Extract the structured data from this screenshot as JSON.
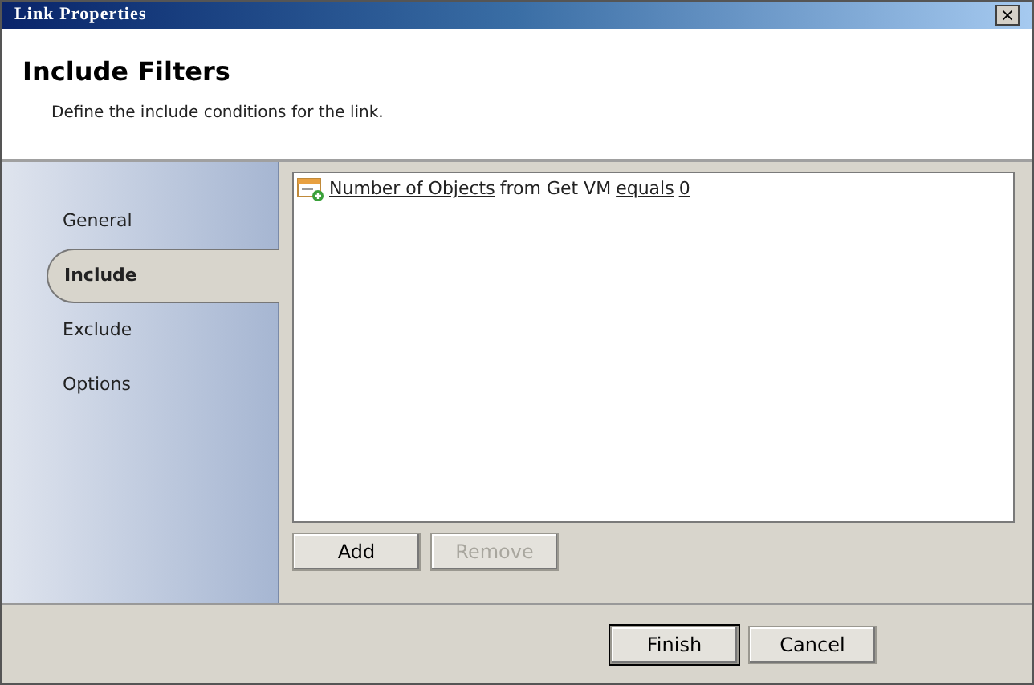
{
  "window": {
    "title": "Link Properties",
    "close": "×"
  },
  "header": {
    "title": "Include Filters",
    "subtitle": "Define the include conditions for the link."
  },
  "sidebar": {
    "items": [
      {
        "label": "General",
        "selected": false
      },
      {
        "label": "Include",
        "selected": true
      },
      {
        "label": "Exclude",
        "selected": false
      },
      {
        "label": "Options",
        "selected": false
      }
    ]
  },
  "conditions": [
    {
      "parts": [
        {
          "text": "Number of Objects",
          "kind": "link"
        },
        {
          "text": "from Get VM",
          "kind": "text"
        },
        {
          "text": "equals",
          "kind": "link"
        },
        {
          "text": "0",
          "kind": "link"
        }
      ]
    }
  ],
  "list_buttons": [
    {
      "label": "Add",
      "disabled": false
    },
    {
      "label": "Remove",
      "disabled": true
    }
  ],
  "footer_buttons": [
    {
      "label": "Finish",
      "default": true
    },
    {
      "label": "Cancel",
      "default": false
    }
  ]
}
